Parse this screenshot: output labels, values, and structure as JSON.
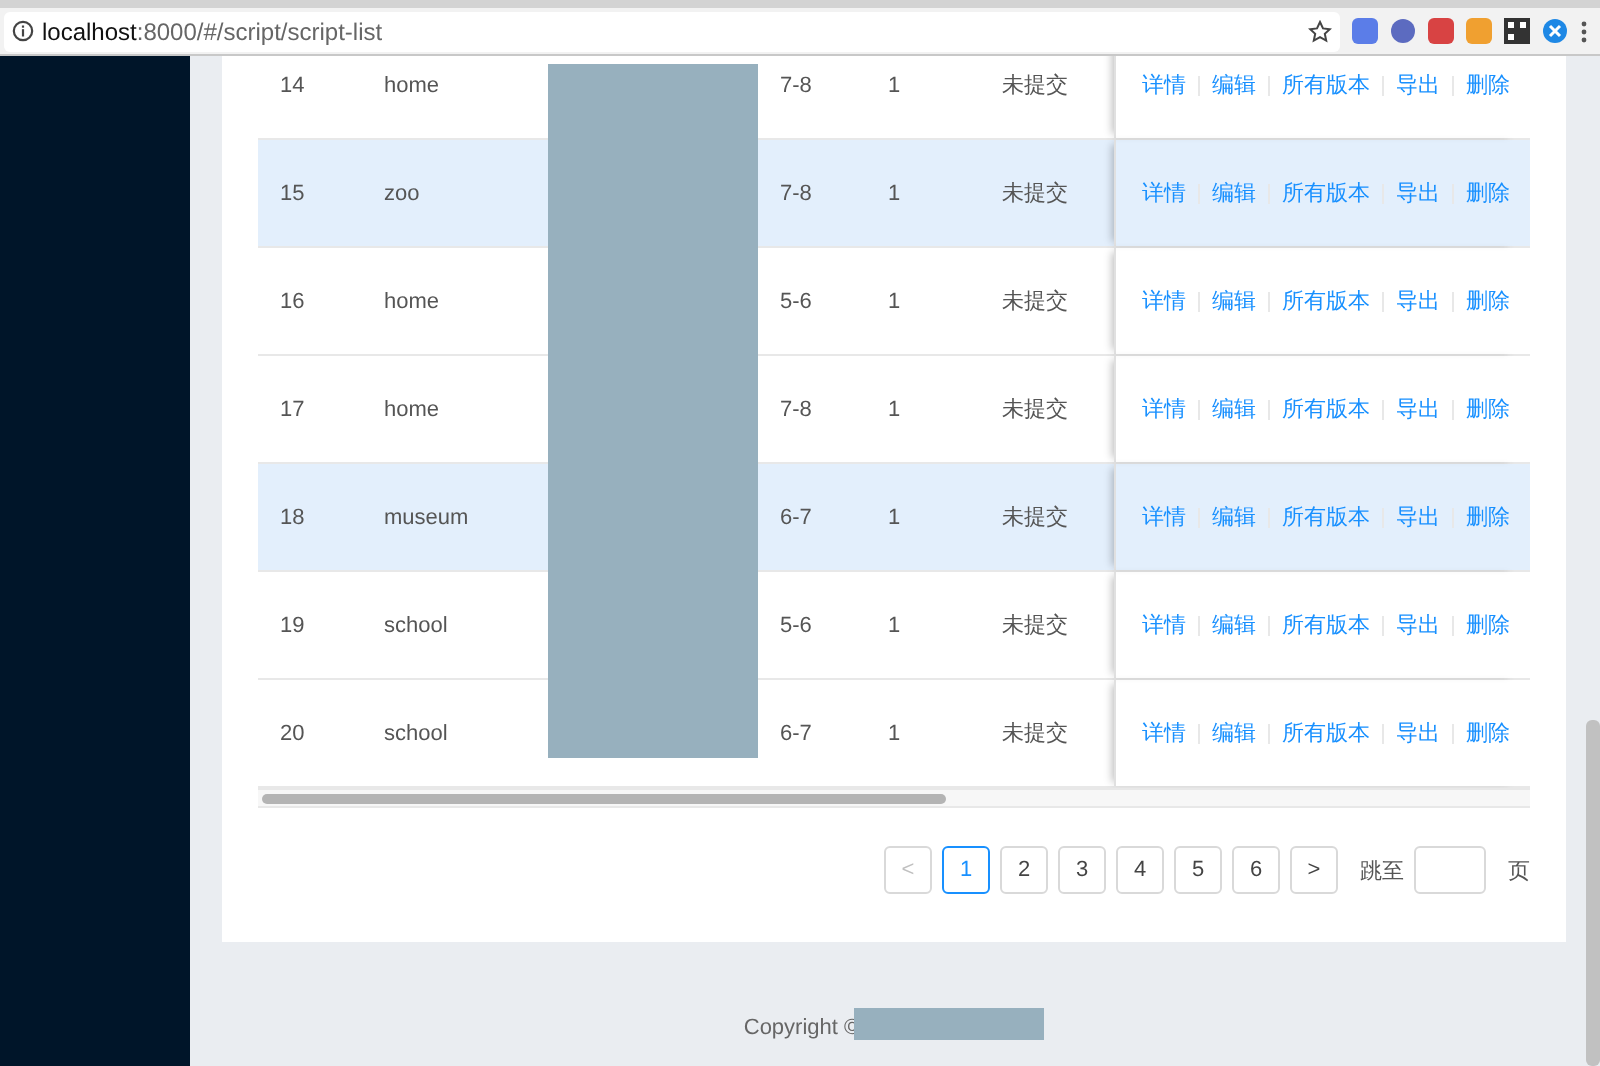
{
  "browser": {
    "url_host": "localhost",
    "url_rest": ":8000/#/script/script-list"
  },
  "rows": [
    {
      "id": "14",
      "name": "home",
      "grade": "7-8",
      "count": "1",
      "status": "未提交",
      "highlighted": false,
      "actions": [
        "详情",
        "编辑",
        "所有版本",
        "导出",
        "删除"
      ]
    },
    {
      "id": "15",
      "name": "zoo",
      "grade": "7-8",
      "count": "1",
      "status": "未提交",
      "highlighted": true,
      "actions": [
        "详情",
        "编辑",
        "所有版本",
        "导出",
        "删除"
      ]
    },
    {
      "id": "16",
      "name": "home",
      "grade": "5-6",
      "count": "1",
      "status": "未提交",
      "highlighted": false,
      "actions": [
        "详情",
        "编辑",
        "所有版本",
        "导出",
        "删除"
      ]
    },
    {
      "id": "17",
      "name": "home",
      "grade": "7-8",
      "count": "1",
      "status": "未提交",
      "highlighted": false,
      "actions": [
        "详情",
        "编辑",
        "所有版本",
        "导出",
        "删除"
      ]
    },
    {
      "id": "18",
      "name": "museum",
      "grade": "6-7",
      "count": "1",
      "status": "未提交",
      "highlighted": true,
      "actions": [
        "详情",
        "编辑",
        "所有版本",
        "导出",
        "删除"
      ]
    },
    {
      "id": "19",
      "name": "school",
      "grade": "5-6",
      "count": "1",
      "status": "未提交",
      "highlighted": false,
      "actions": [
        "详情",
        "编辑",
        "所有版本",
        "导出",
        "删除"
      ]
    },
    {
      "id": "20",
      "name": "school",
      "grade": "6-7",
      "count": "1",
      "status": "未提交",
      "highlighted": false,
      "actions": [
        "详情",
        "编辑",
        "所有版本",
        "导出",
        "删除"
      ]
    }
  ],
  "pagination": {
    "prev": "<",
    "pages": [
      {
        "label": "1",
        "selected": true
      },
      {
        "label": "2",
        "selected": false
      },
      {
        "label": "3",
        "selected": false
      },
      {
        "label": "4",
        "selected": false
      },
      {
        "label": "5",
        "selected": false
      },
      {
        "label": "6",
        "selected": false
      }
    ],
    "next": ">",
    "jump_label": "跳至",
    "jump_suffix": "页"
  },
  "footer": {
    "copyright": "Copyright ©"
  }
}
